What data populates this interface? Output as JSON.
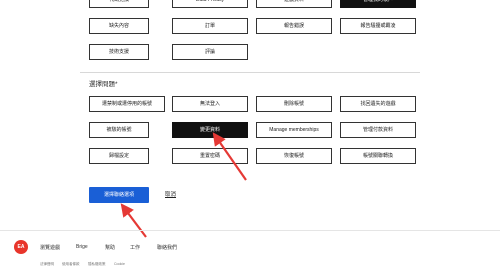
{
  "top_options": [
    {
      "label": "代碼兌換",
      "selected": false
    },
    {
      "label": "Data Privacy",
      "selected": false
    },
    {
      "label": "遊戲資料",
      "selected": false
    },
    {
      "label": "管理我的帳戶",
      "selected": true
    },
    {
      "label": "缺失內容",
      "selected": false
    },
    {
      "label": "訂單",
      "selected": false
    },
    {
      "label": "報告錯誤",
      "selected": false
    },
    {
      "label": "報告騷擾或霸凌",
      "selected": false
    },
    {
      "label": "技術支援",
      "selected": false
    },
    {
      "label": "評論",
      "selected": false
    }
  ],
  "issue_section": {
    "title": "選擇問題*",
    "options": [
      {
        "label": "遭禁制或遭停用的帳號",
        "selected": false
      },
      {
        "label": "無法登入",
        "selected": false
      },
      {
        "label": "刪除帳號",
        "selected": false
      },
      {
        "label": "找回遺失的遊戲",
        "selected": false
      },
      {
        "label": "被駭的帳號",
        "selected": false
      },
      {
        "label": "變更資料",
        "selected": true
      },
      {
        "label": "Manage memberships",
        "selected": false
      },
      {
        "label": "管理付款資料",
        "selected": false
      },
      {
        "label": "歸檔設定",
        "selected": false
      },
      {
        "label": "重置密碼",
        "selected": false
      },
      {
        "label": "恢復帳號",
        "selected": false
      },
      {
        "label": "帳號關聯轉換",
        "selected": false
      }
    ]
  },
  "actions": {
    "primary_label": "選擇聯絡選項",
    "cancel_label": "取消"
  },
  "footer": {
    "logo_text": "EA",
    "links": [
      "瀏覽遊戲",
      "Brige",
      "幫助",
      "工作",
      "聯絡我們"
    ],
    "sublinks": [
      "法律聲明",
      "使用者條款",
      "隱私權政策",
      "Cookie"
    ]
  },
  "colors": {
    "accent": "#1a5fd6",
    "selected_bg": "#111111",
    "annotation_arrow": "#e53935",
    "logo": "#e8352b"
  }
}
